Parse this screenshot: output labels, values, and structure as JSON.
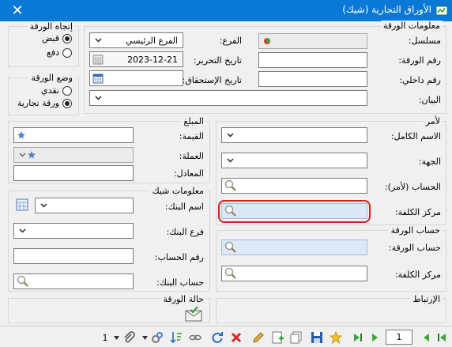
{
  "window": {
    "title": "الأوراق التجارية (شيك)",
    "close_glyph": "✕"
  },
  "direction": {
    "title": "إتجاه الورقة",
    "options": [
      {
        "label": "قبض",
        "selected": true
      },
      {
        "label": "دفع",
        "selected": false
      }
    ]
  },
  "paper_status": {
    "title": "وضع الورقة",
    "options": [
      {
        "label": "نقدي",
        "selected": false
      },
      {
        "label": "ورقة تجارية",
        "selected": true
      }
    ]
  },
  "paper_info": {
    "title": "معلومات الورقة",
    "serial_label": "مسلسل:",
    "paper_no_label": "رقم الورقة:",
    "internal_no_label": "رقم داخلي:",
    "statement_label": "البيان:",
    "branch_label": "الفرع:",
    "branch_value": "الفرع الرئيسي",
    "edit_date_label": "تاريخ التحرير:",
    "edit_date_value": "2023-12-21",
    "due_date_label": "تاريخ الإستحقاق:"
  },
  "amount": {
    "title": "المبلغ",
    "value_label": "القيمة:",
    "currency_label": "العملة:",
    "equivalent_label": "المعادل:"
  },
  "order": {
    "title": "لأمر",
    "full_name_label": "الاسم الكامل:",
    "entity_label": "الجهة:",
    "account_label": "الحساب (لأمر):",
    "cost_center_label": "مركز الكلفة:"
  },
  "check_info": {
    "title": "معلومات شيك",
    "bank_name_label": "اسم البنك:",
    "bank_branch_label": "فرع البنك:",
    "account_no_label": "رقم الحساب:",
    "bank_account_label": "حساب البنك:"
  },
  "paper_account": {
    "title": "حساب الورقة",
    "account_label": "حساب الورقة:",
    "cost_center_label": "مركز الكلفة:"
  },
  "paper_state": {
    "title": "حالة الورقة"
  },
  "link": {
    "title": "الإرتباط"
  },
  "toolbar": {
    "page_value": "1",
    "count_value": "1"
  }
}
